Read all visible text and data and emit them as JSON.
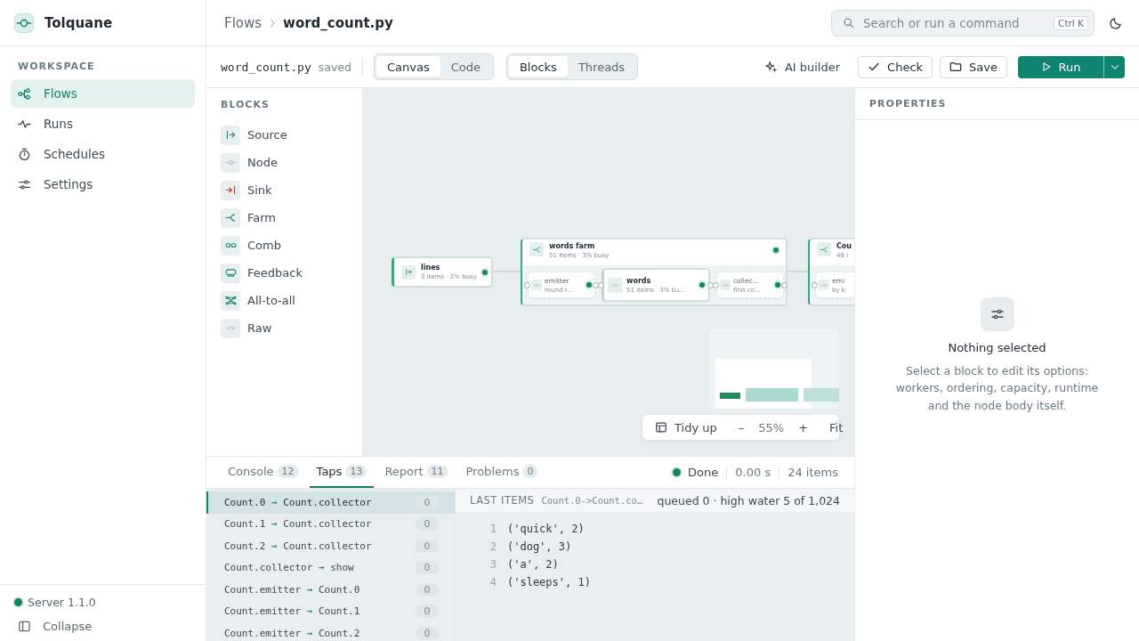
{
  "app": {
    "name": "Tolquane"
  },
  "breadcrumb": {
    "parent": "Flows",
    "current": "word_count.py"
  },
  "search": {
    "placeholder": "Search or run a command",
    "shortcut": "Ctrl K"
  },
  "sidebar": {
    "section": "WORKSPACE",
    "items": [
      {
        "label": "Flows",
        "kind": "flows",
        "selected": true
      },
      {
        "label": "Runs",
        "kind": "runs",
        "selected": false
      },
      {
        "label": "Schedules",
        "kind": "schedules",
        "selected": false
      },
      {
        "label": "Settings",
        "kind": "settings",
        "selected": false
      }
    ],
    "server": {
      "label": "Server 1.1.0"
    },
    "collapse": "Collapse"
  },
  "toolbar": {
    "file": "word_count.py",
    "file_state": "saved",
    "view_tabs": [
      {
        "label": "Canvas",
        "selected": true
      },
      {
        "label": "Code",
        "selected": false
      }
    ],
    "mode_tabs": [
      {
        "label": "Blocks",
        "selected": true
      },
      {
        "label": "Threads",
        "selected": false
      }
    ],
    "ai": "AI builder",
    "check": "Check",
    "save": "Save",
    "run": "Run"
  },
  "blocks": {
    "title": "BLOCKS",
    "items": [
      {
        "label": "Source",
        "kind": "source"
      },
      {
        "label": "Node",
        "kind": "node"
      },
      {
        "label": "Sink",
        "kind": "sink"
      },
      {
        "label": "Farm",
        "kind": "farm"
      },
      {
        "label": "Comb",
        "kind": "comb"
      },
      {
        "label": "Feedback",
        "kind": "feedback"
      },
      {
        "label": "All-to-all",
        "kind": "alltoall"
      },
      {
        "label": "Raw",
        "kind": "raw"
      }
    ]
  },
  "canvas": {
    "nodes": [
      {
        "kind": "source",
        "title": "lines",
        "subtitle": "3 items · 2% busy"
      },
      {
        "kind": "farm",
        "title": "words farm",
        "subtitle": "51 items · 3% busy",
        "children": [
          {
            "kind": "node",
            "title": "emitter",
            "subtitle": "round r…"
          },
          {
            "kind": "node",
            "title": "words",
            "subtitle": "51 items · 3% bu…"
          },
          {
            "kind": "node",
            "title": "collec…",
            "subtitle": "first co…"
          }
        ]
      },
      {
        "kind": "farm",
        "title": "Cou",
        "subtitle": "48 i",
        "children": [
          {
            "kind": "node",
            "title": "emi",
            "subtitle": "by k"
          }
        ]
      }
    ],
    "controls": {
      "tidy": "Tidy up",
      "zoom_out": "–",
      "zoom": "55%",
      "zoom_in": "+",
      "fit": "Fit"
    }
  },
  "properties": {
    "title": "PROPERTIES",
    "empty_title": "Nothing selected",
    "empty_text": "Select a block to edit its options: workers, ordering, capacity, runtime and the node body itself."
  },
  "bottom": {
    "tabs": [
      {
        "label": "Console",
        "count": "12",
        "selected": false
      },
      {
        "label": "Taps",
        "count": "13",
        "selected": true
      },
      {
        "label": "Report",
        "count": "11",
        "selected": false
      },
      {
        "label": "Problems",
        "count": "0",
        "selected": false
      }
    ],
    "status": {
      "label": "Done",
      "time": "0.00 s",
      "items": "24 items"
    },
    "taps": [
      {
        "from": "Count.0",
        "arrow": "→",
        "to": "Count.collector",
        "count": "0",
        "selected": true
      },
      {
        "from": "Count.1",
        "arrow": "→",
        "to": "Count.collector",
        "count": "0",
        "selected": false
      },
      {
        "from": "Count.2",
        "arrow": "→",
        "to": "Count.collector",
        "count": "0",
        "selected": false
      },
      {
        "from": "Count.collector",
        "arrow": "→",
        "to": "show",
        "count": "0",
        "selected": false
      },
      {
        "from": "Count.emitter",
        "arrow": "→",
        "to": "Count.0",
        "count": "0",
        "selected": false
      },
      {
        "from": "Count.emitter",
        "arrow": "→",
        "to": "Count.1",
        "count": "0",
        "selected": false
      },
      {
        "from": "Count.emitter",
        "arrow": "→",
        "to": "Count.2",
        "count": "0",
        "selected": false
      }
    ],
    "detail": {
      "title": "LAST ITEMS",
      "path": "Count.0->Count.co…",
      "queue": "queued 0 · high water 5 of 1,024",
      "lines": [
        {
          "number": "1",
          "text": "('quick', 2)"
        },
        {
          "number": "2",
          "text": "('dog', 3)"
        },
        {
          "number": "3",
          "text": "('a', 2)"
        },
        {
          "number": "4",
          "text": "('sleeps', 1)"
        }
      ]
    }
  }
}
